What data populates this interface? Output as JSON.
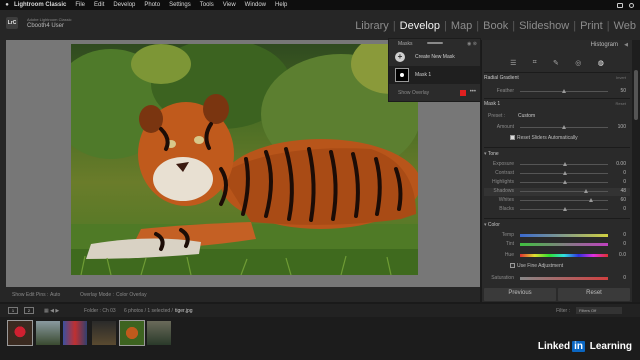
{
  "menubar": {
    "app_name": "Lightroom Classic",
    "items": [
      "File",
      "Edit",
      "Develop",
      "Photo",
      "Settings",
      "Tools",
      "View",
      "Window",
      "Help"
    ]
  },
  "identity": {
    "line1": "Adobe Lightroom Classic",
    "line2": "Cbooth4 User",
    "badge": "LrC"
  },
  "modules": {
    "items": [
      "Library",
      "Develop",
      "Map",
      "Book",
      "Slideshow",
      "Print",
      "Web"
    ],
    "active": "Develop"
  },
  "mask_panel": {
    "title": "Masks",
    "create_label": "Create New Mask",
    "mask_name": "Mask 1",
    "show_overlay_label": "Show Overlay"
  },
  "toolbar": {
    "show_edit_pins_label": "Show Edit Pins :",
    "show_edit_pins_value": "Auto",
    "overlay_mode_label": "Overlay Mode :",
    "overlay_mode_value": "Color Overlay"
  },
  "right_panel": {
    "histogram_label": "Histogram",
    "radial_gradient_label": "Radial Gradient",
    "invert_label": "Invert",
    "feather_label": "Feather",
    "feather_value": "50",
    "mask_label": "Mask 1",
    "reset_label": "Reset",
    "preset_label": "Preset :",
    "preset_value": "Custom",
    "amount_label": "Amount",
    "amount_value": "100",
    "reset_sliders_label": "Reset Sliders Automatically",
    "tone_header": "Tone",
    "tone_sliders": [
      {
        "label": "Exposure",
        "value": "0.00",
        "pos": 0.5
      },
      {
        "label": "Contrast",
        "value": "0",
        "pos": 0.5
      },
      {
        "label": "Highlights",
        "value": "0",
        "pos": 0.5
      },
      {
        "label": "Shadows",
        "value": "48",
        "pos": 0.74
      },
      {
        "label": "Whites",
        "value": "60",
        "pos": 0.8
      },
      {
        "label": "Blacks",
        "value": "0",
        "pos": 0.5
      }
    ],
    "color_header": "Color",
    "color_sliders": [
      {
        "label": "Temp",
        "value": "0"
      },
      {
        "label": "Tint",
        "value": "0"
      },
      {
        "label": "Hue",
        "value": "0.0"
      }
    ],
    "fine_adjust_label": "Use Fine Adjustment",
    "saturation_label": "Saturation",
    "saturation_value": "0",
    "previous_label": "Previous",
    "reset_button_label": "Reset"
  },
  "filmstrip": {
    "monitor1": "1",
    "monitor2": "2",
    "folder_text": "Folder : Ch 03",
    "count_text": "6 photos / 1 selected /",
    "filename": "tiger.jpg",
    "filter_label": "Filter :",
    "filter_value": "Filters Off"
  },
  "watermark": {
    "pre": "Linked",
    "in": "in",
    "post": " Learning"
  },
  "colors": {
    "accent_red": "#e02020",
    "canvas_gray": "#777777",
    "panel_bg": "#2a2a2a"
  }
}
